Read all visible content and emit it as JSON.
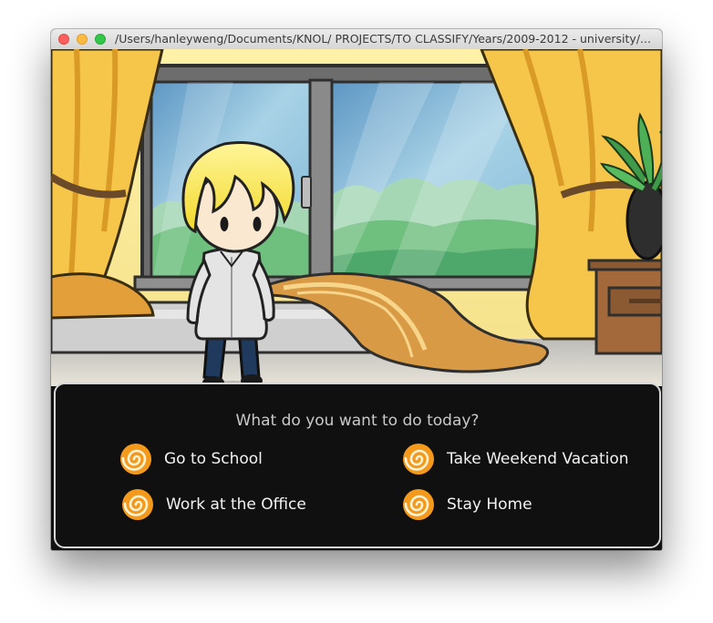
{
  "window": {
    "title": "/Users/hanleyweng/Documents/KNOL/ PROJECTS/TO CLASSIFY/Years/2009-2012 - university/..."
  },
  "dialog": {
    "prompt": "What do you want to do today?",
    "choices": [
      {
        "label": "Go to School",
        "icon": "swirl-icon"
      },
      {
        "label": "Take Weekend Vacation",
        "icon": "swirl-icon"
      },
      {
        "label": "Work at the Office",
        "icon": "swirl-icon"
      },
      {
        "label": "Stay Home",
        "icon": "swirl-icon"
      }
    ]
  },
  "colors": {
    "dialog_bg": "#101010",
    "dialog_border": "#d8d8d8",
    "swirl_orange": "#f39a1c",
    "curtain_yellow": "#f5c64a",
    "sky_blue": "#7fb8d8"
  }
}
